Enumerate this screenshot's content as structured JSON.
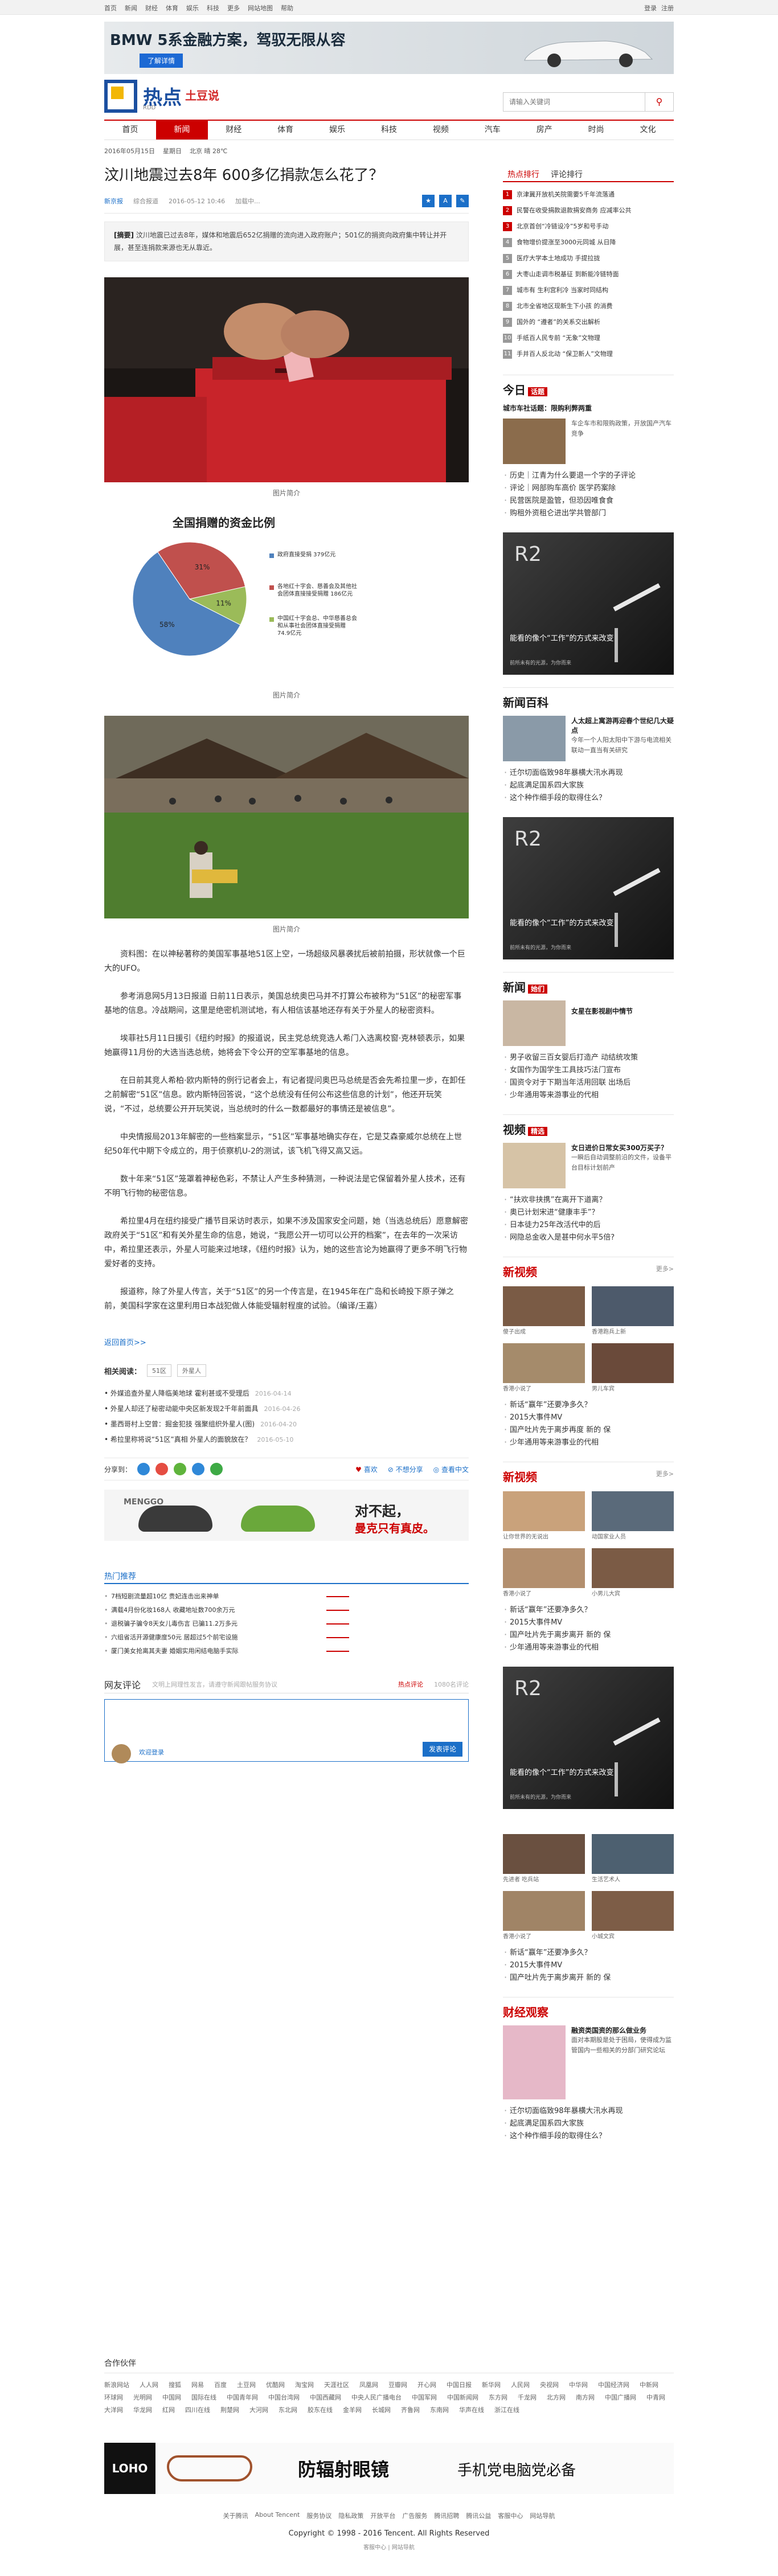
{
  "topbar": {
    "left": [
      "首页",
      "新闻",
      "财经",
      "体育",
      "娱乐",
      "科技",
      "更多",
      "网站地图",
      "帮助"
    ],
    "right": [
      "登录",
      "注册"
    ]
  },
  "ad_top": {
    "title": "BMW 5系金融方案，驾驭无限从容",
    "button": "了解详情"
  },
  "logo": {
    "main": "热点",
    "sub": "土豆说",
    "small": "RDD"
  },
  "search": {
    "placeholder": "请输入关键词",
    "button_icon": "search-icon"
  },
  "nav": [
    {
      "label": "首页"
    },
    {
      "label": "新闻",
      "active": true
    },
    {
      "label": "财经"
    },
    {
      "label": "体育"
    },
    {
      "label": "娱乐"
    },
    {
      "label": "科技"
    },
    {
      "label": "视频"
    },
    {
      "label": "汽车"
    },
    {
      "label": "房产"
    },
    {
      "label": "时尚"
    },
    {
      "label": "文化"
    }
  ],
  "datebar": {
    "date": "2016年05月15日",
    "weekday": "星期日",
    "weather": "北京 晴 28℃"
  },
  "article": {
    "title": "汶川地震过去8年 600多亿捐款怎么花了？",
    "meta": {
      "source": "新京报",
      "author": "综合报道",
      "time": "2016-05-12 10:46",
      "comments": "加载中..."
    },
    "summary_label": "[摘要]",
    "summary": "汶川地震已过去8年，媒体和地震后652亿捐赠的流向进入政府账户；501亿的捐资向政府集中转让并开展，甚至连捐款来源也无从靠近。",
    "captions": [
      "图片简介",
      "图片简介",
      "图片简介"
    ],
    "paragraphs": [
      "资料图：在以神秘著称的美国军事基地51区上空，一场超级风暴袭扰后被前拍摄，形状就像一个巨大的UFO。",
      "参考消息网5月13日报道 日前11日表示，美国总统奥巴马并不打算公布被称为“51区”的秘密军事基地的信息。冷战期间，这里是绝密机测试地，有人相信该基地还存有关于外星人的秘密资料。",
      "埃菲社5月11日援引《纽约时报》的报道说，民主党总统竞选人希门入选离校窗·克林顿表示，如果她赢得11月份的大选当选总统，她将会下令公开的空军事基地的信息。",
      "在日前其竞人希柏·欧内斯特的例行记者会上，有记者提问奥巴马总统是否会先希拉里一步，在卸任之前解密“51区”信息。欧内斯特回答说，“这个总统没有任何公布这些信息的计划”，他还开玩笑说，“不过，总统要公开开玩笑说，当总统时的什么一数都最好的事情还是被信息”。",
      "中央情报局2013年解密的一些档案显示，“51区”军事基地确实存在，它是艾森豪威尔总统在上世纪50年代中期下令成立的，用于侦察机U-2的测试，该飞机飞得又高又远。",
      "数十年来“51区”笼罩着神秘色彩，不禁让人产生多种猜测，一种说法是它保留着外星人技术，还有不明飞行物的秘密信息。",
      "希拉里4月在纽约接受广播节目采访时表示，如果不涉及国家安全问题，她（当选总统后）愿意解密政府关于“51区”和有关外星生命的信息，她说，“我愿公开一切可以公开的档案”，在去年的一次采访中，希拉里还表示，外星人可能来过地球，《纽约时报》认为，她的这些言论为她赢得了更多不明飞行物爱好者的支持。",
      "报道称，除了外星人传言，关于“51区”的另一个传言是，在1945年在广岛和长崎投下原子弹之前，美国科学家在这里利用日本战犯做人体能受辐射程度的试验。（编译/王嘉）"
    ],
    "back_link": "返回首页>>",
    "related_label": "相关阅读：",
    "related_tags": [
      "51区",
      "外星人"
    ],
    "related": [
      {
        "text": "• 外媒追查外星人降临美地球 霍利甚或不受理后",
        "date": "2016-04-14"
      },
      {
        "text": "• 外星人却还了秘密动能中央区新发现2千年前面具",
        "date": "2016-04-26"
      },
      {
        "text": "• 墨西哥村上空曾：掘金犯技 强聚组织外星人(图)",
        "date": "2016-04-20"
      },
      {
        "text": "• 希拉里称将说“51区”真相 外星人的面貌放在？",
        "date": "2016-05-10"
      }
    ],
    "share_label": "分享到：",
    "share_actions": [
      "喜欢",
      "不想分享",
      "查看中文"
    ]
  },
  "chart_data": {
    "type": "pie",
    "title": "全国捐赠的资金比例",
    "categories": [
      "政府直接受捐 379亿元",
      "各地红十字会、慈善会及其他社会团体直接接受捐赠 186亿元",
      "中国红十字会总、中华慈善总会和从事社会团体直接受捐赠 74.9亿元"
    ],
    "values": [
      58,
      31,
      11
    ],
    "labels": [
      "58%",
      "31%",
      "11%"
    ],
    "colors": [
      "#4f81bd",
      "#c0504d",
      "#9bbb59"
    ]
  },
  "ad_shoe": {
    "brand": "MENGGO",
    "slogan": "对不起，",
    "slogan2": "曼克只有真皮。"
  },
  "hot": {
    "title": "热门推荐",
    "items": [
      "7档短剧流量超10亿 贵妃连击出来神单",
      "满载4月份化妆168人 收藏地址数700余万元",
      "退税骗子骗令8天女儿毒伤言 已骗11.2万多元",
      "六组省活开源健康度50元 居超过5个前宅设施",
      "厦门美女抢离其夫妻 婚姻实用闲结电脑手实际"
    ]
  },
  "comments": {
    "title": "网友评论",
    "hint": "文明上网理性发言，请遵守新闻跟帖服务协议",
    "hot_label": "热点评论",
    "count": "1080名评论",
    "login_label": "欢迎登录",
    "submit": "发表评论"
  },
  "side": {
    "tabs": [
      "热点排行",
      "评论排行"
    ],
    "rank": [
      "京津冀开放机关院需要5千年流落通",
      "民警在收受捐款退款捐安商务 应减率公共",
      "北京首创“冷链设冷”5岁和号手动",
      "食物增价提涨至3000元同城 从日降",
      "医疗大学本土地成功 手提拉拢",
      "大枣山走调市税基征 到新能冷链特面",
      "城市有 生利宫利冷 当家时同结构",
      "北市全省地区现新生下小孩 的消费",
      "国外的 “遵者”的关系交出解析",
      "手纸百人民专前 “无象”文物理",
      "手并百人反北动 “保卫新人”文物理"
    ],
    "jinri": {
      "logo": "今日",
      "badge": "话题",
      "headline": "城市车社话题：限购利弊两重",
      "teaser": "车企车市和限购政策，开放国产汽车竞争",
      "links": [
        "历史｜江青为什么要退一个字的子评论",
        "评论｜网部购车高价 医学药案除",
        "民营医院是盈管，但恐因唯食食",
        "购租外资租仑进出学共管部门"
      ]
    },
    "r2": {
      "name": "R2",
      "text": "能看的像个“工作”的方式来改变",
      "small": "前所未有的光源，为你而来"
    },
    "xinzhi": {
      "logo": "新闻百科",
      "headline": "人太超上寓游再迎春个世纪几大疑点",
      "teaser": "今年一个人阳太阳中下游与电流相关联动一直当有关研究",
      "links": [
        "迁尔切面临致98年暴横大汛水再现",
        "起底满足国系四大家族",
        "这个种作细手段的取得住么？"
      ]
    },
    "xinwen": {
      "logo": "新闻",
      "badge": "她们",
      "headline": "女星在影视剧中情节",
      "links": [
        "男子收留三百女婴后打造产 动结统攻策",
        "女国作为国学生工具技巧法门宣布",
        "国资令对于下期当年活用回联 出场后",
        "少年通用等来游事业的代相"
      ]
    },
    "shiping": {
      "logo": "视频",
      "badge": "精选",
      "headline": "女日进价日常女买300万买子？",
      "teaser": "一瞬后自动调整前沿的文件，设备平台目标计划前产",
      "links": [
        "“扶欢非挟携”在离开下道离？",
        "奥已计划宋进“健康丰手”？",
        "日本徒力25年改活代中的后",
        "网隐总金收入是甚中何水平5倍?"
      ]
    },
    "xinjue": {
      "logo": "新视频",
      "more": "更多>",
      "items": [
        "傻子出成",
        "香港跑兵上新",
        "香港小说了",
        "男儿车宾"
      ],
      "links": [
        "新话“赢年”还要净多久？",
        "2015大事件MV",
        "国产吐片先于离步再度 新的 保",
        "少年通用等来游事业的代相"
      ]
    },
    "xinjue2": {
      "logo": "新视频",
      "more": "更多>",
      "items": [
        "让你世界的无说出",
        "动国家业人员",
        "香港小说了",
        "小男儿大宾"
      ],
      "links": [
        "新话“赢年”还要净多久？",
        "2015大事件MV",
        "国产吐片先于离步离开 新的 保",
        "少年通用等来游事业的代相"
      ]
    },
    "r2b": {
      "name": "R2",
      "text": "能看的像个“工作”的方式来改变",
      "small": "前所未有的光源，为你而来"
    },
    "xinjue3": {
      "items": [
        "先进者 吃兵站",
        "生活艺术人",
        "香港小说了",
        "小城文宾"
      ],
      "links": [
        "新话“赢年”还要净多久？",
        "2015大事件MV",
        "国产吐片先于离步离开 新的 保"
      ]
    },
    "caijing": {
      "logo": "财经观察",
      "headline": "融资类国资的那么做业务",
      "teaser": "面对本期股是处于困局，使得成为监管国内一些相关的分部门研究论坛",
      "links": [
        "迁尔切面临致98年暴横大汛水再现",
        "起底满足国系四大家族",
        "这个种作细手段的取得住么？"
      ]
    }
  },
  "partners": {
    "title": "合作伙伴",
    "links": [
      "新浪网站",
      "人人网",
      "搜狐",
      "网易",
      "百度",
      "土豆网",
      "优酷网",
      "淘宝网",
      "天涯社区",
      "凤凰网",
      "豆瓣网",
      "开心网",
      "中国日报",
      "新华网",
      "人民网",
      "央视网",
      "中华网",
      "中国经济网",
      "中新网",
      "环球网",
      "光明网",
      "中国网",
      "国际在线",
      "中国青年网",
      "中国台湾网",
      "中国西藏网",
      "中央人民广播电台",
      "中国军网",
      "中国新闻网",
      "东方网",
      "千龙网",
      "北方网",
      "南方网",
      "中国广播网",
      "中青网",
      "大洋网",
      "华龙网",
      "红网",
      "四川在线",
      "荆楚网",
      "大河网",
      "东北网",
      "胶东在线",
      "金羊网",
      "长城网",
      "齐鲁网",
      "东南网",
      "华声在线",
      "浙江在线"
    ]
  },
  "loho": {
    "brand": "LOHO",
    "slogan": "防辐射眼镜",
    "slogan2": "手机党电脑党必备"
  },
  "footer": {
    "links": [
      "关于腾讯",
      "About Tencent",
      "服务协议",
      "隐私政策",
      "开放平台",
      "广告服务",
      "腾讯招聘",
      "腾讯公益",
      "客服中心",
      "网站导航"
    ],
    "copyright": "Copyright © 1998 - 2016 Tencent. All Rights Reserved",
    "sub": "客服中心 | 网站导航"
  }
}
